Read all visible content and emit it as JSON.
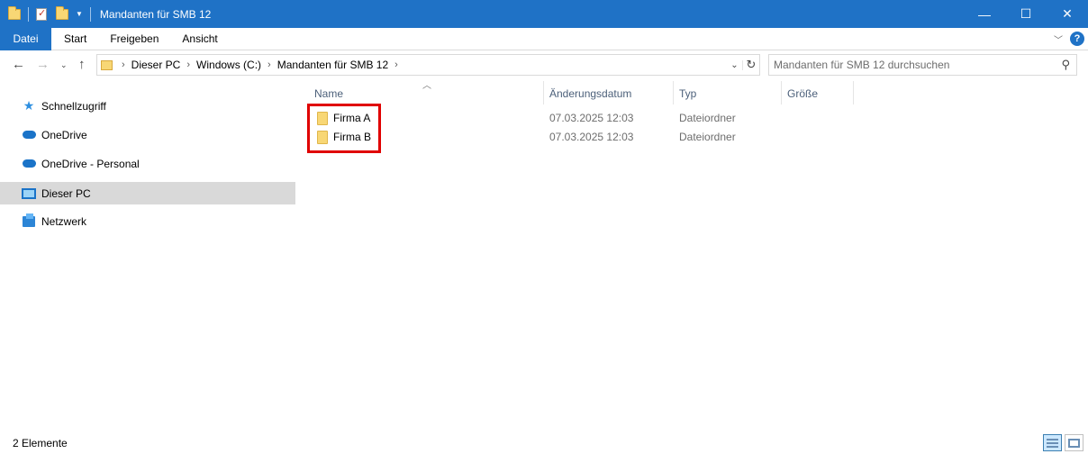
{
  "window": {
    "title": "Mandanten für SMB 12",
    "minimize": "—",
    "maximize": "☐",
    "close": "✕"
  },
  "ribbon": {
    "tabs": [
      "Datei",
      "Start",
      "Freigeben",
      "Ansicht"
    ],
    "help": "?"
  },
  "address": {
    "breadcrumbs": [
      "Dieser PC",
      "Windows (C:)",
      "Mandanten für SMB 12"
    ]
  },
  "search": {
    "placeholder": "Mandanten für SMB 12 durchsuchen"
  },
  "nav": {
    "items": [
      {
        "label": "Schnellzugriff",
        "icon": "star-icon",
        "selected": false
      },
      {
        "label": "OneDrive",
        "icon": "cloud-icon",
        "selected": false
      },
      {
        "label": "OneDrive - Personal",
        "icon": "cloud-icon",
        "selected": false
      },
      {
        "label": "Dieser PC",
        "icon": "computer-icon",
        "selected": true
      },
      {
        "label": "Netzwerk",
        "icon": "network-icon",
        "selected": false
      }
    ]
  },
  "list": {
    "columns": [
      "Name",
      "Änderungsdatum",
      "Typ",
      "Größe"
    ],
    "rows": [
      {
        "name": "Firma A",
        "modified": "07.03.2025 12:03",
        "type": "Dateiordner",
        "size": ""
      },
      {
        "name": "Firma B",
        "modified": "07.03.2025 12:03",
        "type": "Dateiordner",
        "size": ""
      }
    ]
  },
  "status": {
    "item_count": "2 Elemente"
  },
  "colors": {
    "title_bar": "#1f72c6",
    "highlight_box": "#e00000",
    "folder": "#f8d775"
  }
}
